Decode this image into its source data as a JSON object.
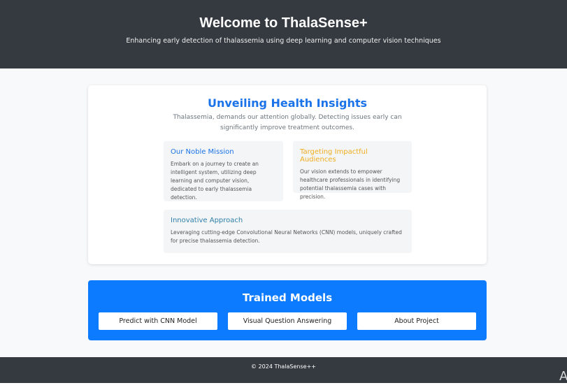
{
  "header": {
    "title": "Welcome to ThalaSense+",
    "subtitle": "Enhancing early detection of thalassemia using deep learning and computer vision techniques"
  },
  "insights": {
    "title": "Unveiling Health Insights",
    "intro": "Thalassemia, demands our attention globally. Detecting issues early can significantly improve treatment outcomes.",
    "cards": [
      {
        "title": "Our Noble Mission",
        "text": "Embark on a journey to create an intelligent system, utilizing deep learning and computer vision, dedicated to early thalassemia detection.",
        "color": "#1a73e8"
      },
      {
        "title": "Targeting Impactful Audiences",
        "text": "Our vision extends to empower healthcare professionals in identifying potential thalassemia cases with precision.",
        "color": "#f0ad1e"
      },
      {
        "title": "Innovative Approach",
        "text": "Leveraging cutting-edge Convolutional Neural Networks (CNN) models, uniquely crafted for precise thalassemia detection.",
        "color": "#2e7fa8"
      }
    ]
  },
  "models": {
    "title": "Trained Models",
    "buttons": [
      "Predict with CNN Model",
      "Visual Question Answering",
      "About Project"
    ],
    "color": "#0d7bff"
  },
  "footer": {
    "text": "© 2024 ThalaSense++"
  },
  "corner_glyph": "A"
}
